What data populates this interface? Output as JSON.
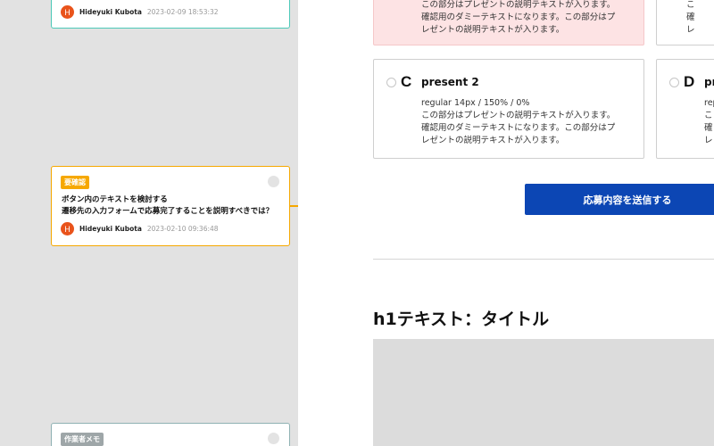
{
  "comments": [
    {
      "id": "top",
      "tag": "",
      "lines": [],
      "author": "Hideyuki Kubota",
      "avatar_initial": "H",
      "timestamp": "2023-02-09 18:53:32"
    },
    {
      "id": "mid",
      "tag": "要確認",
      "lines": [
        "ボタン内のテキストを検討する",
        "遷移先の入力フォームで応募完了することを説明すべきでは？"
      ],
      "author": "Hideyuki Kubota",
      "avatar_initial": "H",
      "timestamp": "2023-02-10 09:36:48"
    },
    {
      "id": "bot",
      "tag": "作業者メモ",
      "lines": [],
      "author": "",
      "avatar_initial": "",
      "timestamp": ""
    }
  ],
  "options": {
    "top_left_desc": [
      "この部分はプレゼントの説明テキストが入ります。",
      "確認用のダミーテキストになります。この部分はプ",
      "レゼントの説明テキストが入ります。"
    ],
    "top_right_desc": [
      "こ",
      "確",
      "レ"
    ],
    "c": {
      "letter": "C",
      "title": "present 2",
      "desc": [
        "regular 14px / 150% / 0%",
        "この部分はプレゼントの説明テキストが入ります。",
        "確認用のダミーテキストになります。この部分はプ",
        "レゼントの説明テキストが入ります。"
      ]
    },
    "d": {
      "letter": "D",
      "title": "pr",
      "desc": [
        "rep",
        "こ",
        "確",
        "レ"
      ]
    }
  },
  "submit_label": "応募内容を送信する",
  "h1_title": "h1テキスト：タイトル",
  "colors": {
    "sidebar_bg": "#e2e2e2",
    "accent_orange": "#f6a800",
    "accent_teal": "#4cc9b8",
    "avatar_red": "#e9531b",
    "submit_blue": "#0c46b4",
    "selected_pink": "#fde3e4"
  }
}
